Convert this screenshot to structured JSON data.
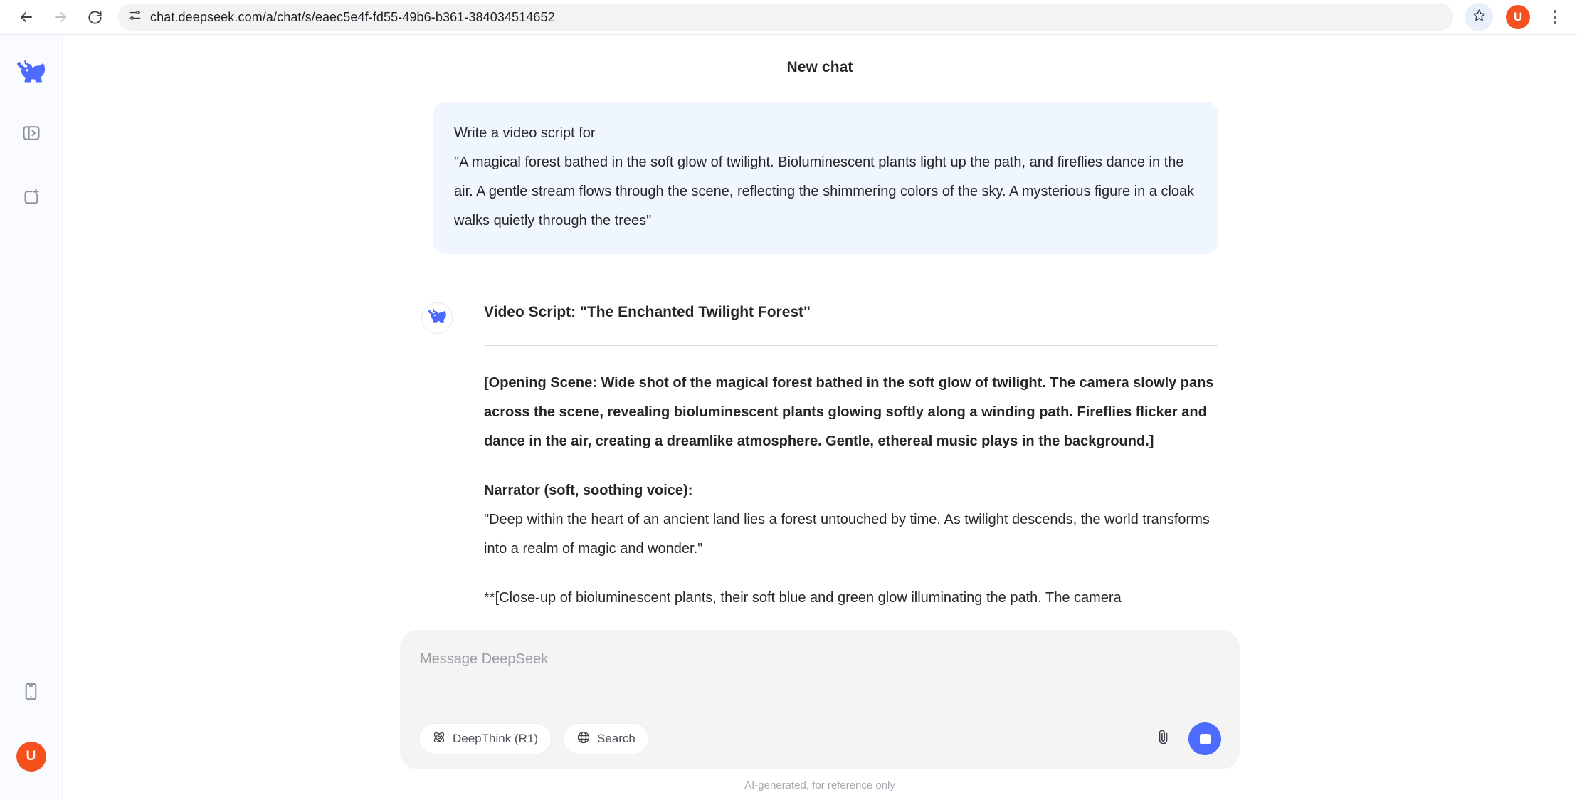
{
  "browser": {
    "back_icon": "arrow-left-icon",
    "forward_icon": "arrow-right-icon",
    "reload_icon": "reload-icon",
    "site_settings_icon": "tune-icon",
    "url": "chat.deepseek.com/a/chat/s/eaec5e4f-fd55-49b6-b361-384034514652",
    "bookmark_icon": "star-icon",
    "profile_initial": "U",
    "menu_icon": "kebab-menu-icon",
    "profile_color": "#f4511e"
  },
  "rail": {
    "logo_icon": "deepseek-whale-logo",
    "expand_sidebar_icon": "expand-sidebar-icon",
    "new_chat_icon": "new-chat-icon",
    "mobile_app_icon": "mobile-phone-icon",
    "avatar_initial": "U",
    "avatar_color": "#f4511e"
  },
  "header": {
    "title": "New chat"
  },
  "conversation": {
    "user_message": {
      "line1": "Write a video script for",
      "line2": "\"A magical forest bathed in the soft glow of twilight. Bioluminescent plants light up the path, and fireflies dance in the air. A gentle stream flows through the scene, reflecting the shimmering colors of the sky. A mysterious figure in a cloak walks quietly through the trees\"",
      "bubble_color": "#eff6ff"
    },
    "assistant_message": {
      "avatar_icon": "deepseek-whale-avatar",
      "title": "Video Script: \"The Enchanted Twilight Forest\"",
      "opening_scene": "[Opening Scene: Wide shot of the magical forest bathed in the soft glow of twilight. The camera slowly pans across the scene, revealing bioluminescent plants glowing softly along a winding path. Fireflies flicker and dance in the air, creating a dreamlike atmosphere. Gentle, ethereal music plays in the background.]",
      "narrator_heading": "Narrator (soft, soothing voice):",
      "narrator_line": "\"Deep within the heart of an ancient land lies a forest untouched by time. As twilight descends, the world transforms into a realm of magic and wonder.\"",
      "next_scene_partial": "**[Close-up of bioluminescent plants, their soft blue and green glow illuminating the path. The camera"
    }
  },
  "composer": {
    "placeholder": "Message DeepSeek",
    "deepthink_label": "DeepThink (R1)",
    "deepthink_icon": "atom-icon",
    "search_label": "Search",
    "search_icon": "globe-icon",
    "attach_icon": "paperclip-icon",
    "send_icon": "stop-square-icon",
    "send_color": "#4d6bfe",
    "disclaimer": "AI-generated, for reference only"
  }
}
